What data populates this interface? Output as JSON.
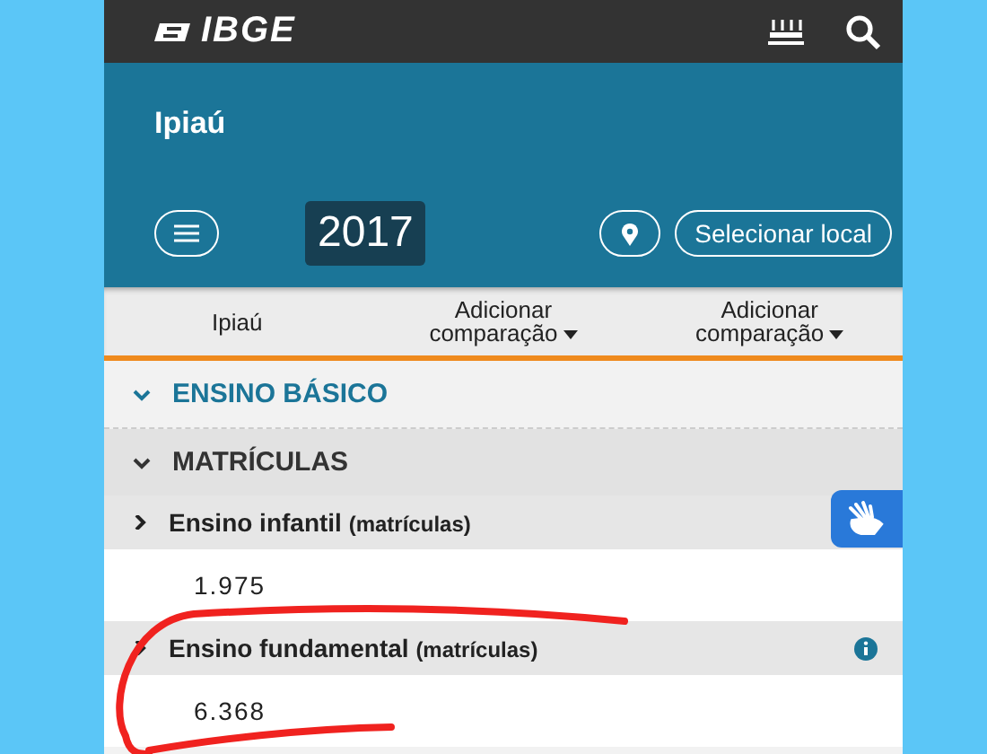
{
  "topbar": {
    "logo": "IBGE"
  },
  "place": {
    "title": "Ipiaú",
    "year": "2017",
    "select_button": "Selecionar local"
  },
  "comparison": [
    {
      "label": "Ipiaú",
      "kind": "place"
    },
    {
      "label": "Adicionar comparação",
      "kind": "dropdown"
    },
    {
      "label": "Adicionar comparação",
      "kind": "dropdown"
    }
  ],
  "sections": [
    {
      "title": "ENSINO BÁSICO",
      "kind": "section",
      "expanded": true
    },
    {
      "title": "MATRÍCULAS",
      "kind": "group",
      "expanded": true
    }
  ],
  "indicators": [
    {
      "title": "Ensino infantil",
      "unit": "(matrículas)",
      "value": "1.975",
      "expanded": false,
      "info": false
    },
    {
      "title": "Ensino fundamental",
      "unit": "(matrículas)",
      "value": "6.368",
      "expanded": false,
      "info": true
    }
  ]
}
